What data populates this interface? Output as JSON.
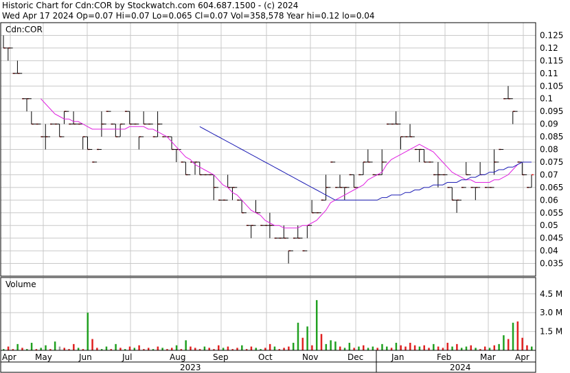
{
  "header": {
    "line1": "Historic Chart for Cdn:COR by Stockwatch.com 604.687.1500 - (c) 2024",
    "line2": "Wed Apr 17 2024   Op=0.07   Hi=0.07   Lo=0.065   Cl=0.07   Vol=358,578   Year hi=0.12   lo=0.04"
  },
  "price_panel": {
    "symbol_label": "Cdn:COR"
  },
  "volume_panel": {
    "label": "Volume"
  },
  "chart_data": [
    {
      "type": "ohlc",
      "title": "Historic Chart for Cdn:COR",
      "ylabel": "",
      "ylim": [
        0.03,
        0.13
      ],
      "yticks": [
        "0.125",
        "0.12",
        "0.115",
        "0.11",
        "0.105",
        "0.1",
        "0.095",
        "0.09",
        "0.085",
        "0.08",
        "0.075",
        "0.07",
        "0.065",
        "0.06",
        "0.055",
        "0.05",
        "0.045",
        "0.04",
        "0.035"
      ],
      "months": [
        "Apr",
        "May",
        "Jun",
        "Jul",
        "Aug",
        "Sep",
        "Oct",
        "Nov",
        "Dec",
        "Jan",
        "Feb",
        "Mar",
        "Apr"
      ],
      "years": [
        "2023",
        "2024"
      ],
      "grid": true,
      "series": [
        {
          "name": "Price",
          "color": "#000000",
          "values": [
            0.12,
            0.12,
            0.11,
            0.11,
            0.1,
            0.1,
            0.09,
            0.09,
            0.085,
            0.085,
            0.09,
            0.09,
            0.085,
            0.095,
            0.09,
            0.09,
            0.09,
            0.085,
            0.08,
            0.075,
            0.08,
            0.09,
            0.095,
            0.09,
            0.085,
            0.09,
            0.095,
            0.09,
            0.09,
            0.085,
            0.09,
            0.09,
            0.085,
            0.09,
            0.085,
            0.085,
            0.08,
            0.08,
            0.075,
            0.07,
            0.075,
            0.075,
            0.07,
            0.07,
            0.07,
            0.065,
            0.06,
            0.06,
            0.065,
            0.065,
            0.06,
            0.055,
            0.05,
            0.05,
            0.055,
            0.05,
            0.05,
            0.05,
            0.045,
            0.045,
            0.045,
            0.04,
            0.045,
            0.045,
            0.04,
            0.05,
            0.055,
            0.055,
            0.06,
            0.065,
            0.075,
            0.065,
            0.065,
            0.065,
            0.07,
            0.065,
            0.07,
            0.075,
            0.075,
            0.07,
            0.07,
            0.075,
            0.09,
            0.09,
            0.09,
            0.085,
            0.085,
            0.085,
            0.08,
            0.08,
            0.075,
            0.075,
            0.07,
            0.07,
            0.07,
            0.065,
            0.06,
            0.06,
            0.065,
            0.07,
            0.065,
            0.065,
            0.07,
            0.065,
            0.065,
            0.075,
            0.08,
            0.1,
            0.1,
            0.095,
            0.075,
            0.07,
            0.065,
            0.07
          ]
        },
        {
          "name": "Moving average (short)",
          "color": "#e020e0",
          "values": [
            null,
            null,
            null,
            null,
            null,
            null,
            null,
            null,
            0.1,
            0.098,
            0.096,
            0.094,
            0.093,
            0.092,
            0.092,
            0.091,
            0.091,
            0.09,
            0.089,
            0.088,
            0.088,
            0.088,
            0.088,
            0.088,
            0.088,
            0.088,
            0.088,
            0.089,
            0.089,
            0.089,
            0.089,
            0.088,
            0.088,
            0.087,
            0.086,
            0.085,
            0.083,
            0.081,
            0.079,
            0.077,
            0.076,
            0.074,
            0.073,
            0.072,
            0.071,
            0.07,
            0.068,
            0.066,
            0.065,
            0.063,
            0.062,
            0.06,
            0.058,
            0.056,
            0.055,
            0.054,
            0.052,
            0.051,
            0.05,
            0.05,
            0.049,
            0.049,
            0.049,
            0.049,
            0.05,
            0.05,
            0.051,
            0.052,
            0.054,
            0.056,
            0.059,
            0.06,
            0.061,
            0.062,
            0.063,
            0.064,
            0.065,
            0.066,
            0.068,
            0.069,
            0.07,
            0.071,
            0.074,
            0.076,
            0.077,
            0.078,
            0.079,
            0.08,
            0.081,
            0.082,
            0.081,
            0.08,
            0.079,
            0.077,
            0.075,
            0.073,
            0.071,
            0.07,
            0.069,
            0.068,
            0.068,
            0.067,
            0.067,
            0.067,
            0.067,
            0.068,
            0.068,
            0.069,
            0.07,
            0.072,
            0.074,
            0.075,
            0.075,
            0.075
          ]
        },
        {
          "name": "Moving average (long)",
          "color": "#1c1cb4",
          "values": [
            null,
            null,
            null,
            null,
            null,
            null,
            null,
            null,
            null,
            null,
            null,
            null,
            null,
            null,
            null,
            null,
            null,
            null,
            null,
            null,
            null,
            null,
            null,
            null,
            null,
            null,
            null,
            null,
            null,
            null,
            null,
            null,
            null,
            null,
            null,
            null,
            null,
            null,
            null,
            null,
            null,
            null,
            0.089,
            0.088,
            0.087,
            0.086,
            0.085,
            0.084,
            0.083,
            0.082,
            0.081,
            0.08,
            0.079,
            0.078,
            0.077,
            0.076,
            0.075,
            0.074,
            0.073,
            0.072,
            0.071,
            0.07,
            0.069,
            0.068,
            0.067,
            0.066,
            0.065,
            0.064,
            0.063,
            0.062,
            0.061,
            0.06,
            0.06,
            0.06,
            0.06,
            0.06,
            0.06,
            0.06,
            0.06,
            0.06,
            0.06,
            0.061,
            0.061,
            0.062,
            0.062,
            0.062,
            0.063,
            0.063,
            0.064,
            0.064,
            0.065,
            0.065,
            0.066,
            0.066,
            0.066,
            0.067,
            0.067,
            0.067,
            0.068,
            0.068,
            0.069,
            0.069,
            0.07,
            0.07,
            0.071,
            0.071,
            0.072,
            0.072,
            0.073,
            0.073,
            0.074,
            0.075,
            0.075,
            0.075
          ]
        }
      ]
    },
    {
      "type": "bar",
      "title": "Volume",
      "yticks": [
        "4.5 M",
        "3.0 M",
        "1.5 M"
      ],
      "ylim": [
        0,
        5.8
      ],
      "unit": "M",
      "up_color": "#20a020",
      "down_color": "#e02020",
      "neutral_color": "#a0a0a0",
      "values": [
        0.1,
        0.3,
        0.1,
        0.5,
        0.2,
        0.1,
        0.6,
        0.1,
        0.2,
        0.4,
        0.1,
        0.7,
        0.3,
        0.2,
        0.1,
        0.5,
        0.2,
        0.1,
        3.0,
        0.9,
        0.2,
        0.1,
        0.3,
        0.1,
        0.5,
        0.2,
        0.1,
        0.3,
        0.2,
        0.4,
        0.1,
        0.2,
        0.1,
        0.3,
        0.2,
        0.1,
        0.2,
        0.4,
        0.1,
        0.8,
        0.3,
        0.2,
        0.1,
        0.3,
        0.2,
        0.1,
        0.4,
        0.2,
        0.3,
        0.1,
        0.2,
        0.4,
        0.1,
        0.3,
        0.2,
        0.1,
        0.2,
        0.5,
        0.3,
        0.1,
        0.2,
        0.3,
        0.6,
        2.2,
        1.0,
        1.9,
        0.4,
        4.0,
        1.3,
        0.5,
        0.8,
        0.7,
        0.3,
        0.2,
        0.6,
        0.2,
        0.3,
        0.4,
        0.2,
        0.3,
        0.2,
        0.5,
        0.3,
        0.2,
        0.6,
        0.4,
        0.3,
        0.6,
        0.4,
        0.3,
        0.4,
        0.2,
        0.5,
        0.3,
        0.2,
        0.6,
        0.3,
        0.5,
        0.2,
        0.3,
        0.4,
        0.2,
        0.1,
        0.3,
        0.2,
        0.4,
        0.5,
        1.2,
        0.9,
        2.2,
        2.3,
        1.0,
        0.4,
        0.3
      ],
      "colors": [
        "g",
        "r",
        "r",
        "g",
        "r",
        "g",
        "g",
        "r",
        "g",
        "g",
        "r",
        "g",
        "n",
        "r",
        "r",
        "r",
        "g",
        "r",
        "g",
        "r",
        "r",
        "g",
        "g",
        "r",
        "g",
        "r",
        "g",
        "r",
        "g",
        "r",
        "r",
        "r",
        "g",
        "r",
        "g",
        "r",
        "r",
        "g",
        "r",
        "g",
        "r",
        "r",
        "r",
        "g",
        "r",
        "r",
        "r",
        "g",
        "r",
        "r",
        "r",
        "g",
        "r",
        "r",
        "g",
        "g",
        "r",
        "r",
        "g",
        "r",
        "r",
        "r",
        "g",
        "g",
        "r",
        "g",
        "r",
        "g",
        "r",
        "g",
        "g",
        "g",
        "r",
        "g",
        "g",
        "r",
        "g",
        "r",
        "g",
        "g",
        "r",
        "g",
        "g",
        "r",
        "g",
        "r",
        "r",
        "r",
        "r",
        "g",
        "r",
        "r",
        "g",
        "r",
        "r",
        "r",
        "g",
        "r",
        "g",
        "g",
        "r",
        "g",
        "r",
        "r",
        "g",
        "r",
        "g",
        "g",
        "r",
        "g",
        "r",
        "r",
        "r",
        "g"
      ]
    }
  ],
  "colors": {
    "price": "#000000",
    "close_tick": "#e02020",
    "ma_short": "#e020e0",
    "ma_long": "#1c1cb4",
    "grid": "#c8c8c8"
  }
}
